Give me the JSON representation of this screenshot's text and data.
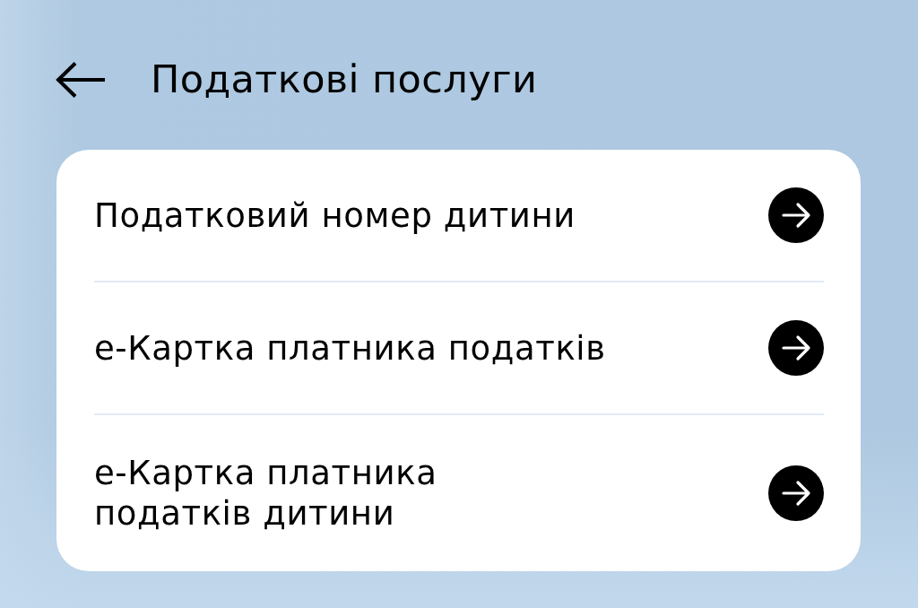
{
  "header": {
    "title": "Податкові послуги"
  },
  "services": [
    {
      "label": "Податковий номер дитини"
    },
    {
      "label": "е-Картка платника податків"
    },
    {
      "label": "е-Картка платника\nподатків дитини"
    }
  ]
}
